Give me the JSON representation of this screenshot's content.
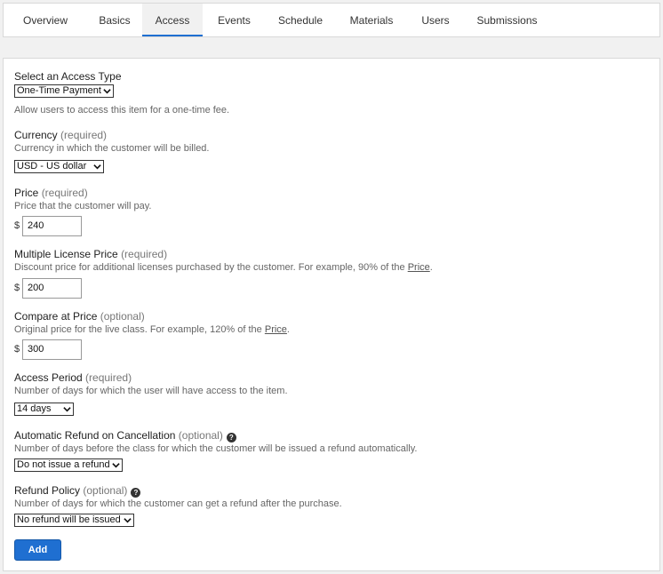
{
  "tabs": [
    "Overview",
    "Basics",
    "Access",
    "Events",
    "Schedule",
    "Materials",
    "Users",
    "Submissions"
  ],
  "active_tab": "Access",
  "access_type": {
    "label": "Select an Access Type",
    "value": "One-Time Payment",
    "desc": "Allow users to access this item for a one-time fee."
  },
  "currency": {
    "label": "Currency",
    "note": "(required)",
    "desc": "Currency in which the customer will be billed.",
    "value": "USD - US dollar"
  },
  "price": {
    "label": "Price",
    "note": "(required)",
    "desc": "Price that the customer will pay.",
    "symbol": "$",
    "value": "240"
  },
  "multi_price": {
    "label": "Multiple License Price",
    "note": "(required)",
    "desc_pre": "Discount price for additional licenses purchased by the customer. For example, 90% of the ",
    "desc_link": "Price",
    "desc_post": ".",
    "symbol": "$",
    "value": "200"
  },
  "compare_price": {
    "label": "Compare at Price",
    "note": "(optional)",
    "desc_pre": "Original price for the live class. For example, 120% of the ",
    "desc_link": "Price",
    "desc_post": ".",
    "symbol": "$",
    "value": "300"
  },
  "access_period": {
    "label": "Access Period",
    "note": "(required)",
    "desc": "Number of days for which the user will have access to the item.",
    "value": "14 days"
  },
  "auto_refund": {
    "label": "Automatic Refund on Cancellation",
    "note": "(optional)",
    "desc": "Number of days before the class for which the customer will be issued a refund automatically.",
    "value": "Do not issue a refund"
  },
  "refund_policy": {
    "label": "Refund Policy",
    "note": "(optional)",
    "desc": "Number of days for which the customer can get a refund after the purchase.",
    "value": "No refund will be issued"
  },
  "help_glyph": "?",
  "add_label": "Add"
}
